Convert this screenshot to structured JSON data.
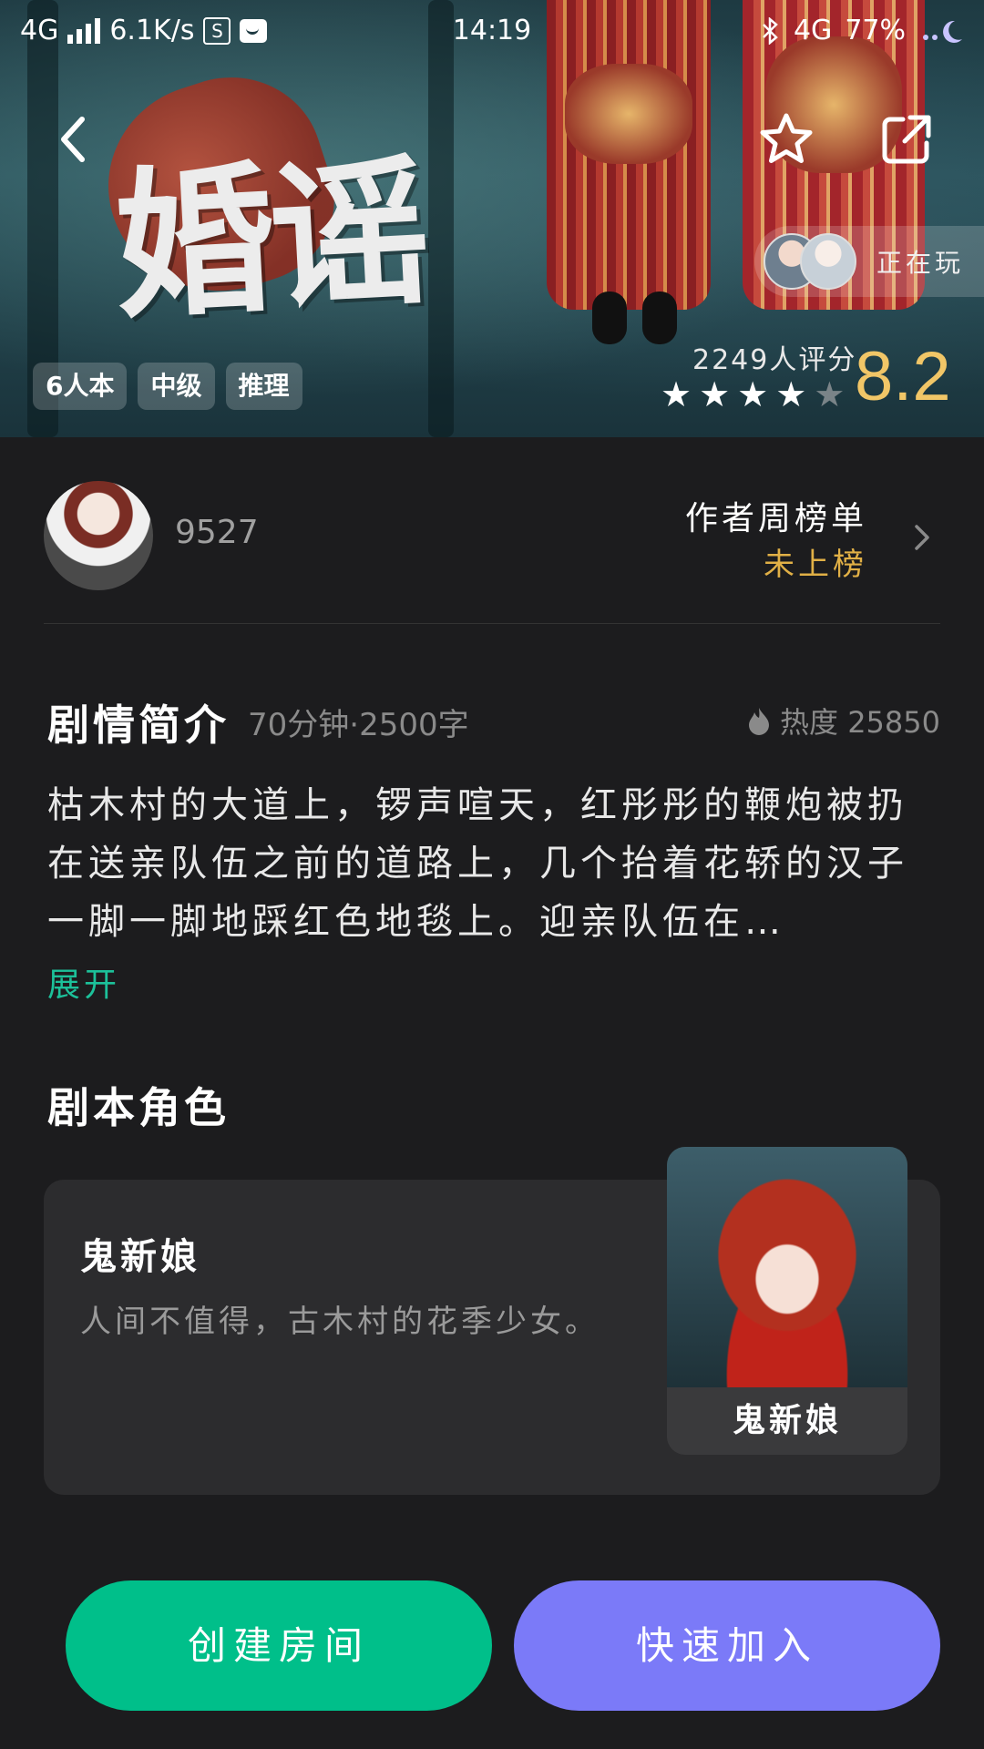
{
  "status_bar": {
    "network": "4G",
    "speed": "6.1K/s",
    "time": "14:19",
    "right_network": "4G",
    "battery": "77%"
  },
  "hero": {
    "title_art": "婚谣",
    "tags": [
      "6人本",
      "中级",
      "推理"
    ],
    "rating_count": "2249人评分",
    "score": "8.2",
    "stars_filled": 4,
    "stars_total": 5,
    "playing_label": "正在玩"
  },
  "author": {
    "name": "9527",
    "rank_title": "作者周榜单",
    "rank_value": "未上榜"
  },
  "intro": {
    "title": "剧情简介",
    "meta": "70分钟·2500字",
    "heat_label": "热度 25850",
    "text": "枯木村的大道上，锣声喧天，红彤彤的鞭炮被扔在送亲队伍之前的道路上，几个抬着花轿的汉子一脚一脚地踩红色地毯上。迎亲队伍在…",
    "expand": "展开"
  },
  "roles": {
    "title": "剧本角色",
    "items": [
      {
        "name": "鬼新娘",
        "desc": "人间不值得，古木村的花季少女。",
        "portrait_label": "鬼新娘"
      }
    ]
  },
  "actions": {
    "create": "创建房间",
    "join": "快速加入"
  },
  "colors": {
    "score": "#f1c667",
    "rank_value": "#e1b046",
    "expand": "#1cc19a",
    "create_button": "#00bf8a",
    "join_button": "#7b7af8"
  }
}
